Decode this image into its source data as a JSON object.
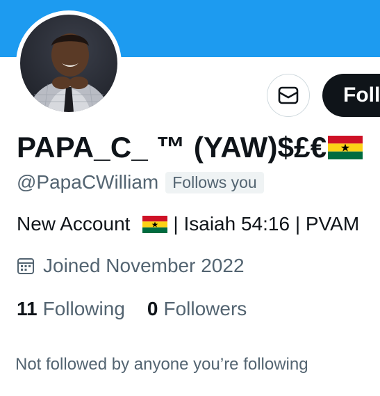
{
  "profile": {
    "banner_color": "#1d9bf0",
    "display_name": "PAPA_C_ ™ (YAW)$£€",
    "handle": "@PapaCWilliam",
    "follows_you_label": "Follows you",
    "bio_prefix": "New Account",
    "bio_suffix": "| Isaiah 54:16 | PVAM",
    "joined": "Joined November 2022",
    "following_count": "11",
    "following_label": "Following",
    "followers_count": "0",
    "followers_label": "Followers",
    "not_followed_text": "Not followed by anyone you’re following"
  },
  "actions": {
    "follow_label": "Follow",
    "message_icon": "envelope-icon"
  },
  "icons": {
    "calendar": "calendar-icon",
    "flag": "ghana-flag-icon"
  },
  "colors": {
    "primary_text": "#0f1419",
    "secondary_text": "#536471",
    "accent": "#1d9bf0",
    "ghana_red": "#ce1126",
    "ghana_yellow": "#fcd116",
    "ghana_green": "#006b3f"
  }
}
